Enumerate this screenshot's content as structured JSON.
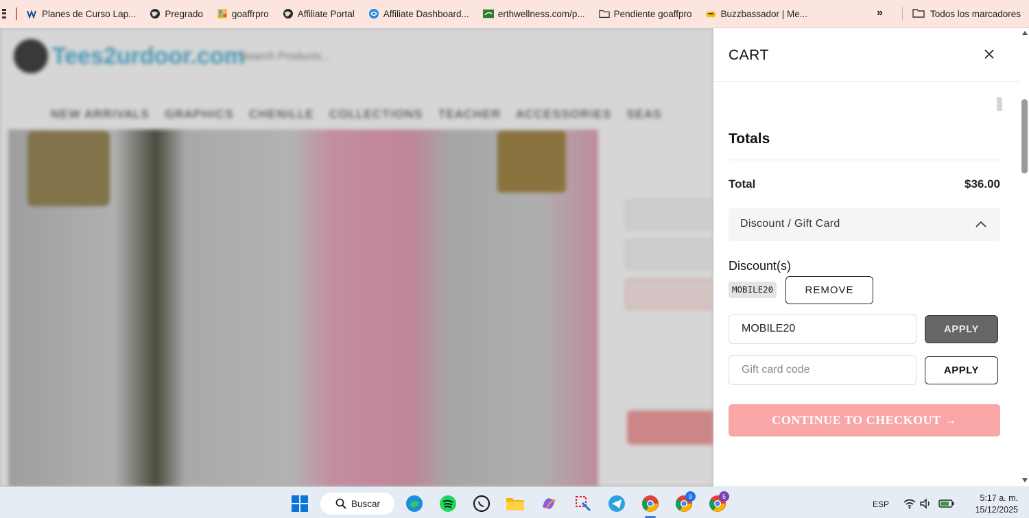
{
  "bookmarks": {
    "items": [
      {
        "label": "Planes de Curso Lap...",
        "icon": "wave-icon"
      },
      {
        "label": "Pregrado",
        "icon": "globe-icon"
      },
      {
        "label": "goaffrpro",
        "icon": "grid-app-icon"
      },
      {
        "label": "Affiliate Portal",
        "icon": "globe-icon"
      },
      {
        "label": "Affiliate Dashboard...",
        "icon": "swirl-icon"
      },
      {
        "label": "erthwellness.com/p...",
        "icon": "leaf-icon"
      },
      {
        "label": "Pendiente goaffpro",
        "icon": "folder-icon"
      },
      {
        "label": "Buzzbassador | Me...",
        "icon": "bee-icon"
      }
    ],
    "more": "»",
    "all_bookmarks": "Todos los marcadores"
  },
  "site": {
    "logo_text": "Tees2urdoor.com",
    "search_placeholder": "Search Products...",
    "nav": [
      "NEW ARRIVALS",
      "GRAPHICS",
      "CHENILLE",
      "COLLECTIONS",
      "TEACHER",
      "ACCESSORIES",
      "SEAS"
    ]
  },
  "cart": {
    "title": "CART",
    "totals_heading": "Totals",
    "total_label": "Total",
    "total_value": "$36.00",
    "discount_accordion_label": "Discount / Gift Card",
    "discounts_heading": "Discount(s)",
    "applied_code": "MOBILE20",
    "remove_label": "REMOVE",
    "discount_input_value": "MOBILE20",
    "apply_label": "APPLY",
    "gift_card_placeholder": "Gift card code",
    "checkout_label": "CONTINUE TO CHECKOUT →"
  },
  "taskbar": {
    "search_label": "Buscar",
    "language": "ESP",
    "time": "5:17 a. m.",
    "date": "15/12/2025",
    "badges": {
      "chrome2": "9",
      "chrome3": "5"
    }
  },
  "colors": {
    "bookmark_bar": "#fbe5de",
    "checkout": "#f8a6a6",
    "apply_dark": "#666666",
    "taskbar": "#e6ecf4"
  }
}
